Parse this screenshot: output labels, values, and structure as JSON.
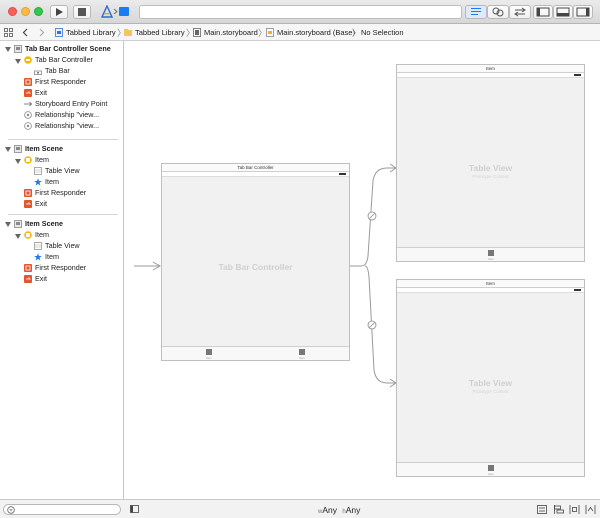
{
  "jumpbar": {
    "items": [
      "Tabbed Library",
      "Tabbed Library",
      "Main.storyboard",
      "Main.storyboard (Base)",
      "No Selection"
    ]
  },
  "outline": {
    "scenes": [
      {
        "title": "Tab Bar Controller Scene",
        "controller": "Tab Bar Controller",
        "children": [
          "Tab Bar"
        ],
        "extras": [
          "First Responder",
          "Exit",
          "Storyboard Entry Point",
          "Relationship \"view...",
          "Relationship \"view..."
        ]
      },
      {
        "title": "Item Scene",
        "controller": "Item",
        "children": [
          "Table View",
          "Item"
        ],
        "extras": [
          "First Responder",
          "Exit"
        ]
      },
      {
        "title": "Item Scene",
        "controller": "Item",
        "children": [
          "Table View",
          "Item"
        ],
        "extras": [
          "First Responder",
          "Exit"
        ]
      }
    ]
  },
  "canvas": {
    "tab_scene": {
      "nav_title": "Tab Bar Controller",
      "center_label": "Tab Bar Controller",
      "tab_labels": [
        "Item",
        "Item"
      ]
    },
    "item_scene_1": {
      "nav_title": "Item",
      "table_label": "Table View",
      "table_sub": "Prototype Content",
      "tab_label": "Item"
    },
    "item_scene_2": {
      "nav_title": "Item",
      "table_label": "Table View",
      "table_sub": "Prototype Content",
      "tab_label": "Item"
    }
  },
  "bottombar": {
    "size_class_w_prefix": "w",
    "size_class_w": "Any",
    "size_class_h_prefix": "h",
    "size_class_h": "Any"
  },
  "colors": {
    "close": "#fc605c",
    "minimize": "#fdbc40",
    "zoom": "#34c84a",
    "accent": "#1a7cf4",
    "scene_icon": "#f5b800",
    "exit_icon": "#e4572e"
  },
  "icons": {
    "run": "play-icon",
    "stop": "stop-icon",
    "scheme": "xcode-app-icon",
    "editor_standard": "standard-editor-icon",
    "editor_assistant": "assistant-editor-icon",
    "editor_version": "version-editor-icon"
  }
}
